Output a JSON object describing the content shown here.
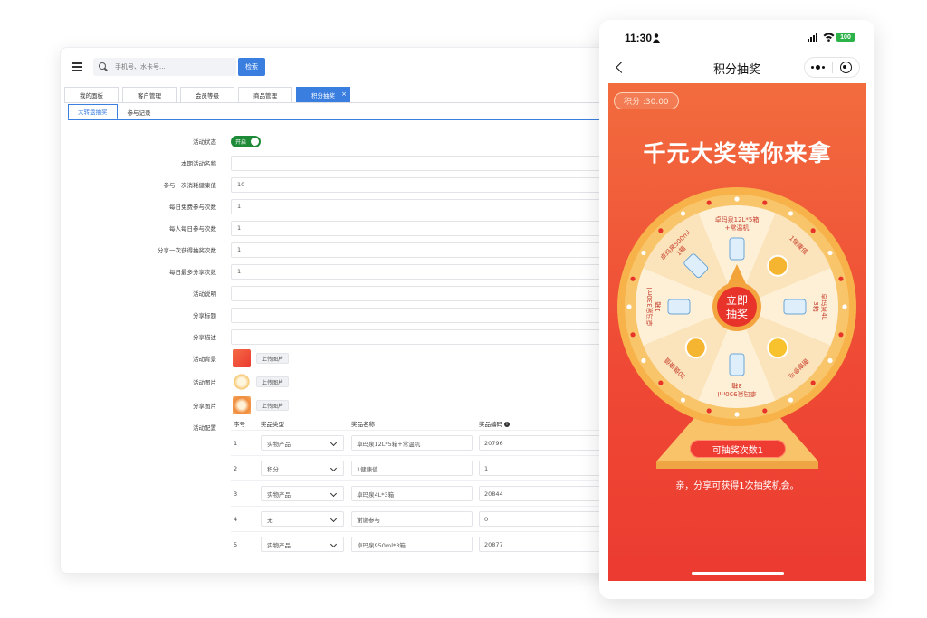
{
  "admin": {
    "search": {
      "placeholder": "手机号、水卡号...",
      "button": "检索"
    },
    "tabs": [
      {
        "label": "我的面板"
      },
      {
        "label": "客户管理"
      },
      {
        "label": "会员等级"
      },
      {
        "label": "商品管理"
      },
      {
        "label": "积分抽奖",
        "active": true,
        "close": "×"
      }
    ],
    "subtabs": [
      {
        "label": "大转盘抽奖",
        "active": true
      },
      {
        "label": "参与记录"
      }
    ],
    "form": {
      "status_label": "活动状态",
      "status_value": "开启",
      "name_label": "本期活动名称",
      "name_value": "",
      "cost_label": "参与一次消耗健康值",
      "cost_value": "10",
      "free_label": "每日免费参与次数",
      "free_value": "1",
      "daily_label": "每人每日参与次数",
      "daily_value": "1",
      "share_gain_label": "分享一次获得抽奖次数",
      "share_gain_value": "1",
      "share_max_label": "每日最多分享次数",
      "share_max_value": "1",
      "desc_label": "活动说明",
      "desc_value": "",
      "share_title_label": "分享标题",
      "share_title_value": "",
      "share_desc_label": "分享描述",
      "share_desc_value": "",
      "bg_label": "活动背景",
      "img_label": "活动图片",
      "share_img_label": "分享图片",
      "upload_label": "上传图片",
      "config_label": "活动配置"
    },
    "prize_table": {
      "headers": {
        "index": "序号",
        "type": "奖品类型",
        "name": "奖品名称",
        "code": "奖品编码"
      },
      "rows": [
        {
          "index": "1",
          "type": "实物产品",
          "name": "卓玛泉12L*5箱+常温机",
          "code": "20796"
        },
        {
          "index": "2",
          "type": "积分",
          "name": "1健康值",
          "code": "1"
        },
        {
          "index": "3",
          "type": "实物产品",
          "name": "卓玛泉4L*3箱",
          "code": "20844"
        },
        {
          "index": "4",
          "type": "无",
          "name": "谢谢参与",
          "code": "0"
        },
        {
          "index": "5",
          "type": "实物产品",
          "name": "卓玛泉950ml*3箱",
          "code": "20877"
        }
      ]
    },
    "colors": {
      "primary": "#3a7ee0",
      "toggle_on": "#1c8a36"
    }
  },
  "phone": {
    "status_bar": {
      "time": "11:30",
      "battery": "100"
    },
    "nav": {
      "title": "积分抽奖"
    },
    "points": "积分 :30.00",
    "headline": "千元大奖等你来拿",
    "wheel": {
      "center_line1": "立即",
      "center_line2": "抽奖",
      "prizes": [
        {
          "label": "卓玛泉12L*5箱",
          "label2": "+常温机",
          "icon": "water-cooler-icon"
        },
        {
          "label": "1健康值",
          "label2": "",
          "icon": "coin-icon"
        },
        {
          "label": "卓玛泉4L",
          "label2": "3箱",
          "icon": "water-bottle-icon"
        },
        {
          "label": "谢谢参与",
          "label2": "",
          "icon": "smile-icon"
        },
        {
          "label": "卓玛泉950ml",
          "label2": "3箱",
          "icon": "bottle-pack-icon"
        },
        {
          "label": "20健康值",
          "label2": "",
          "icon": "coin-icon"
        },
        {
          "label": "卓玛泉330ml",
          "label2": "1箱",
          "icon": "water-bottle-icon"
        },
        {
          "label": "卓玛泉500ml",
          "label2": "1箱",
          "icon": "water-bottle-icon"
        }
      ]
    },
    "draw_count": "可抽奖次数1",
    "share_tip": "亲，分享可获得1次抽奖机会。",
    "colors": {
      "background": "#ef4a35",
      "wheel_rim": "#f7b24a",
      "segment_light": "#fdf0d7",
      "segment_alt": "#fbe4bb",
      "center": "#e8332b"
    }
  }
}
